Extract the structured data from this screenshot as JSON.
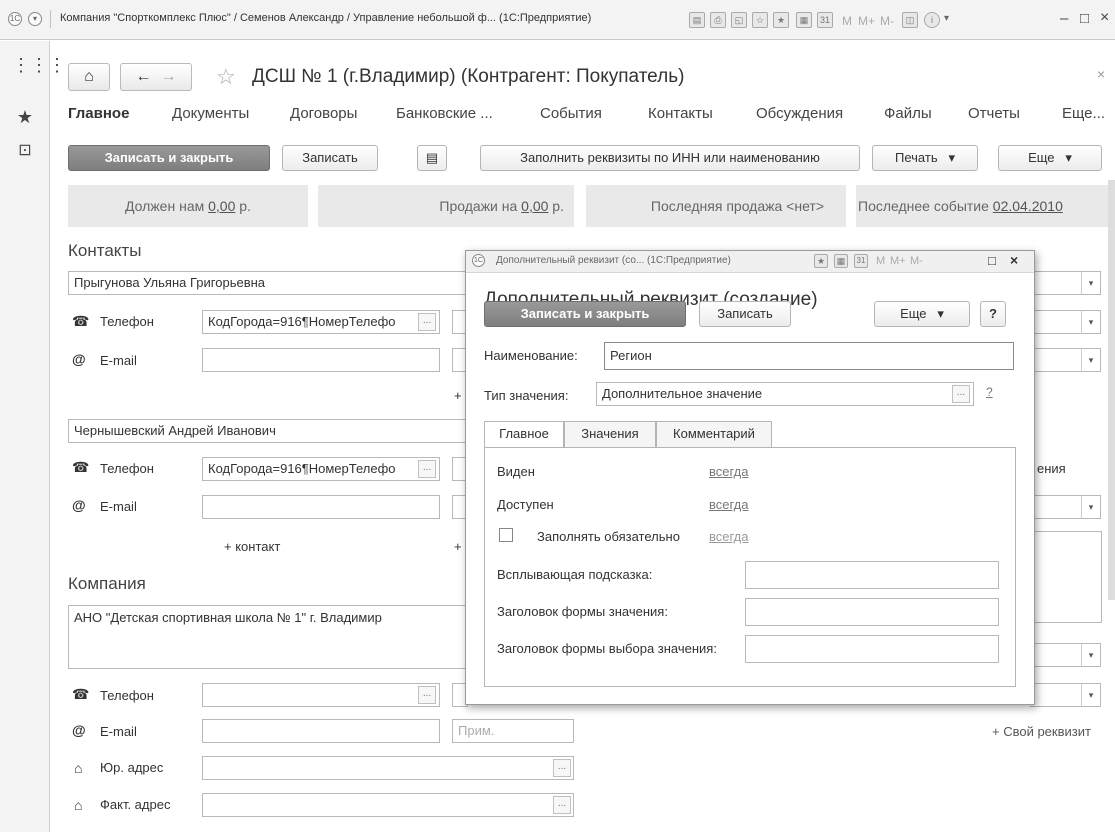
{
  "window": {
    "title": "Компания \"Спорткомплекс Плюс\" / Семенов Александр / Управление небольшой ф...  (1С:Предприятие)",
    "toolbar_labels": [
      "M",
      "M+",
      "M-"
    ],
    "controls": [
      "–",
      "□",
      "×"
    ]
  },
  "form": {
    "title": "ДСШ № 1 (г.Владимир) (Контрагент: Покупатель)",
    "tabs": [
      "Главное",
      "Документы",
      "Договоры",
      "Банковские ...",
      "События",
      "Контакты",
      "Обсуждения",
      "Файлы",
      "Отчеты",
      "Еще..."
    ],
    "buttons": {
      "save_close": "Записать и закрыть",
      "save": "Записать",
      "fill": "Заполнить реквизиты по ИНН или наименованию",
      "print": "Печать",
      "more": "Еще"
    },
    "panels": {
      "owes_prefix": "Должен нам ",
      "owes_value": "0,00",
      "owes_suffix": " р.",
      "sales_prefix": "Продажи на ",
      "sales_value": "0,00",
      "sales_suffix": " р.",
      "last_sale": "Последняя продажа <нет>",
      "last_event_prefix": "Последнее событие ",
      "last_event_value": "02.04.2010"
    },
    "contacts": {
      "heading": "Контакты",
      "contact1_name": "Прыгунова Ульяна Григорьевна",
      "contact2_name": "Чернышевский Андрей Иванович",
      "phone_label": "Телефон",
      "email_label": "E-mail",
      "phone_value": "КодГорода=916¶НомерТелефо",
      "add_contact": "+ контакт",
      "plus": "+"
    },
    "company": {
      "heading": "Компания",
      "name": "АНО \"Детская спортивная школа  № 1\" г. Владимир",
      "phone_label": "Телефон",
      "email_label": "E-mail",
      "note_placeholder": "Прим.",
      "legal_address_label": "Юр. адрес",
      "actual_address_label": "Факт. адрес"
    },
    "right": {
      "partial_label": "ения",
      "own_attr": "+ Свой реквизит"
    }
  },
  "dialog": {
    "window_title": "Дополнительный реквизит (со...  (1С:Предприятие)",
    "heading": "Дополнительный реквизит (создание)",
    "buttons": {
      "save_close": "Записать и закрыть",
      "save": "Записать",
      "more": "Еще",
      "help": "?"
    },
    "name_label": "Наименование:",
    "name_value": "Регион",
    "type_label": "Тип значения:",
    "type_value": "Дополнительное значение",
    "type_help": "?",
    "tabs": [
      "Главное",
      "Значения",
      "Комментарий"
    ],
    "visible_label": "Виден",
    "visible_value": "всегда",
    "available_label": "Доступен",
    "available_value": "всегда",
    "required_label": "Заполнять обязательно",
    "required_value": "всегда",
    "tooltip_label": "Всплывающая подсказка:",
    "value_form_title_label": "Заголовок формы значения:",
    "choice_form_title_label": "Заголовок формы выбора значения:"
  }
}
